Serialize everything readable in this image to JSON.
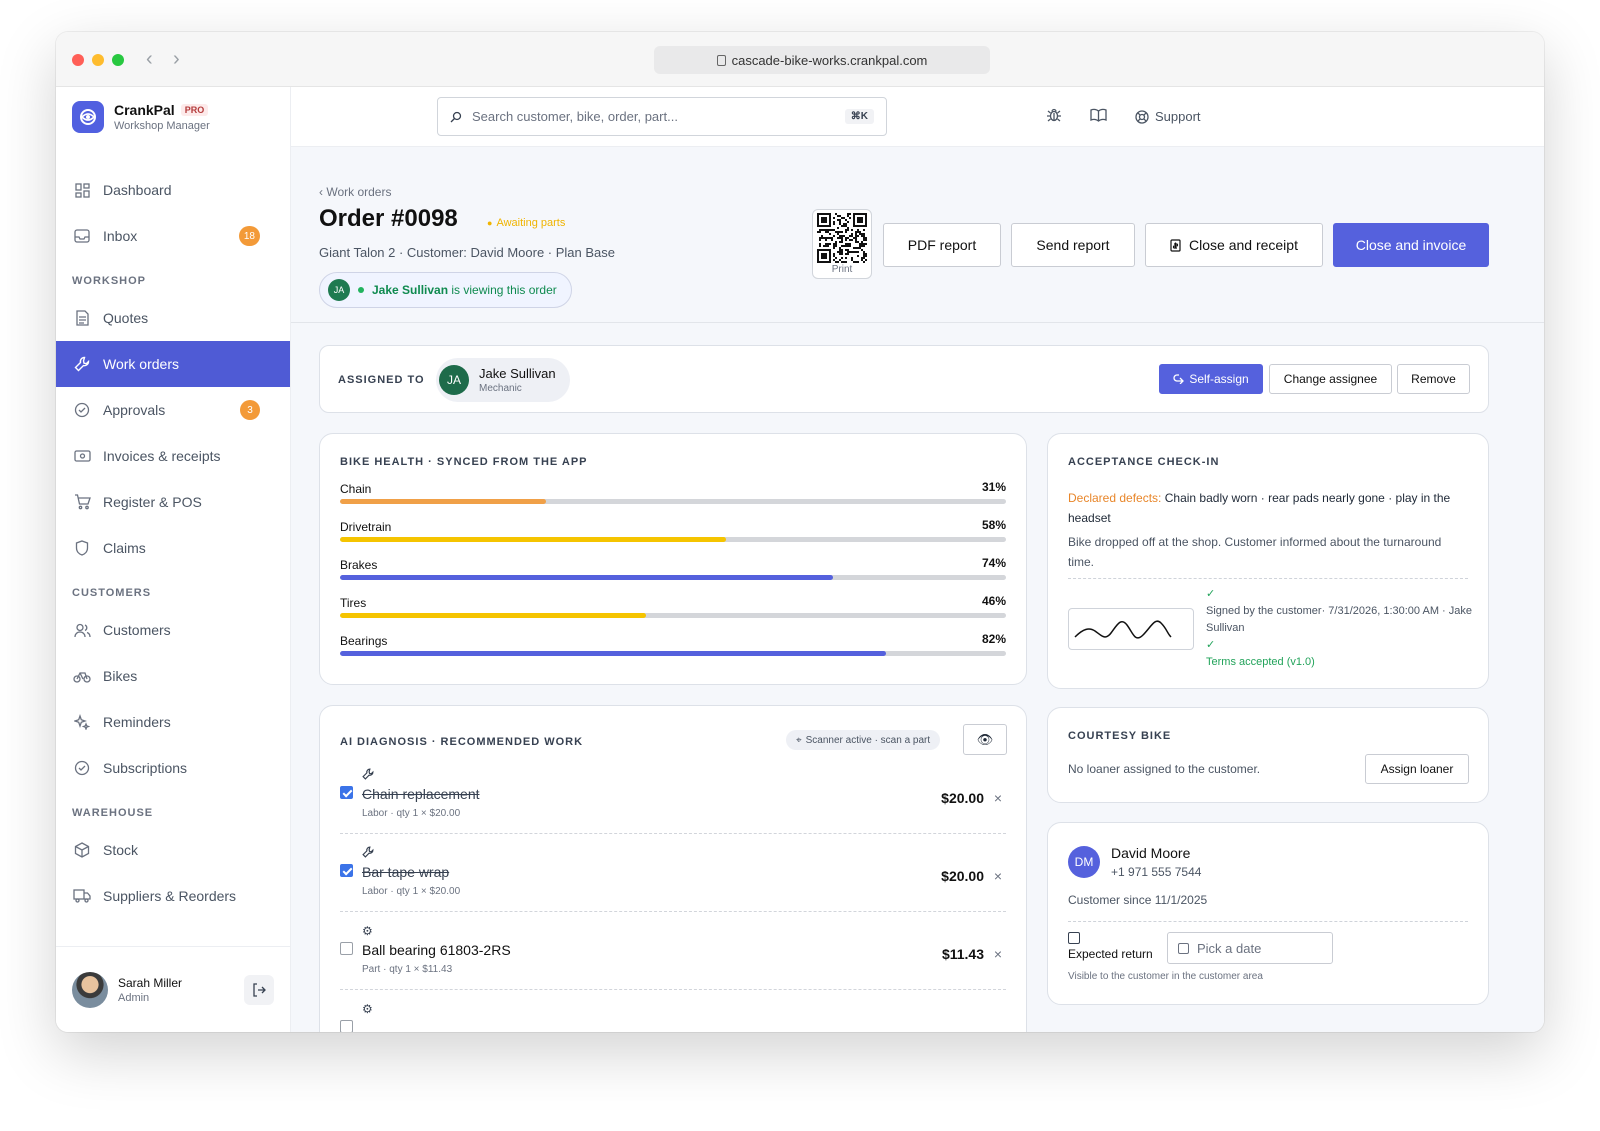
{
  "browser": {
    "url": "cascade-bike-works.crankpal.com"
  },
  "brand": {
    "name": "CrankPal",
    "badge": "PRO",
    "subtitle": "Workshop Manager"
  },
  "search": {
    "placeholder": "Search customer, bike, order, part...",
    "shortcut": "⌘K"
  },
  "topbar": {
    "support_label": "Support"
  },
  "sidebar": {
    "items": [
      {
        "label": "Dashboard"
      },
      {
        "label": "Inbox",
        "badge": "18"
      }
    ],
    "sections": [
      {
        "title": "WORKSHOP",
        "items": [
          {
            "label": "Quotes"
          },
          {
            "label": "Work orders",
            "active": true
          },
          {
            "label": "Approvals",
            "badge": "3"
          },
          {
            "label": "Invoices & receipts"
          },
          {
            "label": "Register & POS"
          },
          {
            "label": "Claims"
          }
        ]
      },
      {
        "title": "CUSTOMERS",
        "items": [
          {
            "label": "Customers"
          },
          {
            "label": "Bikes"
          },
          {
            "label": "Reminders"
          },
          {
            "label": "Subscriptions"
          }
        ]
      },
      {
        "title": "WAREHOUSE",
        "items": [
          {
            "label": "Stock"
          },
          {
            "label": "Suppliers & Reorders"
          }
        ]
      }
    ],
    "user": {
      "name": "Sarah Miller",
      "role": "Admin"
    }
  },
  "order": {
    "breadcrumb": "‹ Work orders",
    "title": "Order #0098",
    "status": "Awaiting parts",
    "subtitle": "Giant Talon 2 · Customer: David Moore · Plan Base",
    "viewer_initials": "JA",
    "viewer_name": "Jake Sullivan",
    "viewer_suffix": "is viewing this order",
    "qr_caption": "Print",
    "buttons": {
      "pdf": "PDF report",
      "send": "Send report",
      "close_receipt": "Close and receipt",
      "close_invoice": "Close and invoice"
    }
  },
  "assigned": {
    "label": "ASSIGNED TO",
    "initials": "JA",
    "name": "Jake Sullivan",
    "role": "Mechanic",
    "self_assign": "Self-assign",
    "change": "Change assignee",
    "remove": "Remove"
  },
  "health": {
    "title": "BIKE HEALTH · SYNCED FROM THE APP",
    "rows": [
      {
        "label": "Chain",
        "pct": "31%",
        "value": 31,
        "color": "#f0a048"
      },
      {
        "label": "Drivetrain",
        "pct": "58%",
        "value": 58,
        "color": "#f5c400"
      },
      {
        "label": "Brakes",
        "pct": "74%",
        "value": 74,
        "color": "#5561dd"
      },
      {
        "label": "Tires",
        "pct": "46%",
        "value": 46,
        "color": "#f5c400"
      },
      {
        "label": "Bearings",
        "pct": "82%",
        "value": 82,
        "color": "#5561dd"
      }
    ]
  },
  "acceptance": {
    "title": "ACCEPTANCE CHECK-IN",
    "defects_label": "Declared defects:",
    "defects": "Chain badly worn · rear pads nearly gone · play in the headset",
    "note": "Bike dropped off at the shop. Customer informed about the turnaround time.",
    "signed": "Signed by the customer· 7/31/2026, 1:30:00 AM · Jake Sullivan",
    "terms": "Terms accepted (v1.0)"
  },
  "diagnosis": {
    "title": "AI DIAGNOSIS · RECOMMENDED WORK",
    "scanner": "Scanner active · scan a part",
    "items": [
      {
        "checked": true,
        "icon": "wrench",
        "name": "Chain replacement",
        "meta": "Labor · qty 1 × $20.00",
        "price": "$20.00"
      },
      {
        "checked": true,
        "icon": "wrench",
        "name": "Bar tape wrap",
        "meta": "Labor · qty 1 × $20.00",
        "price": "$20.00"
      },
      {
        "checked": false,
        "icon": "gear",
        "name": "Ball bearing 61803-2RS",
        "meta": "Part · qty 1 × $11.43",
        "price": "$11.43"
      },
      {
        "checked": false,
        "icon": "gear",
        "name": "",
        "meta": "",
        "price": ""
      }
    ]
  },
  "courtesy": {
    "title": "COURTESY BIKE",
    "text": "No loaner assigned to the customer.",
    "button": "Assign loaner"
  },
  "customer": {
    "initials": "DM",
    "name": "David Moore",
    "phone": "+1 971 555 7544",
    "since": "Customer since 11/1/2025",
    "return_label": "Expected return",
    "date_placeholder": "Pick a date",
    "return_note": "Visible to the customer in the customer area"
  }
}
